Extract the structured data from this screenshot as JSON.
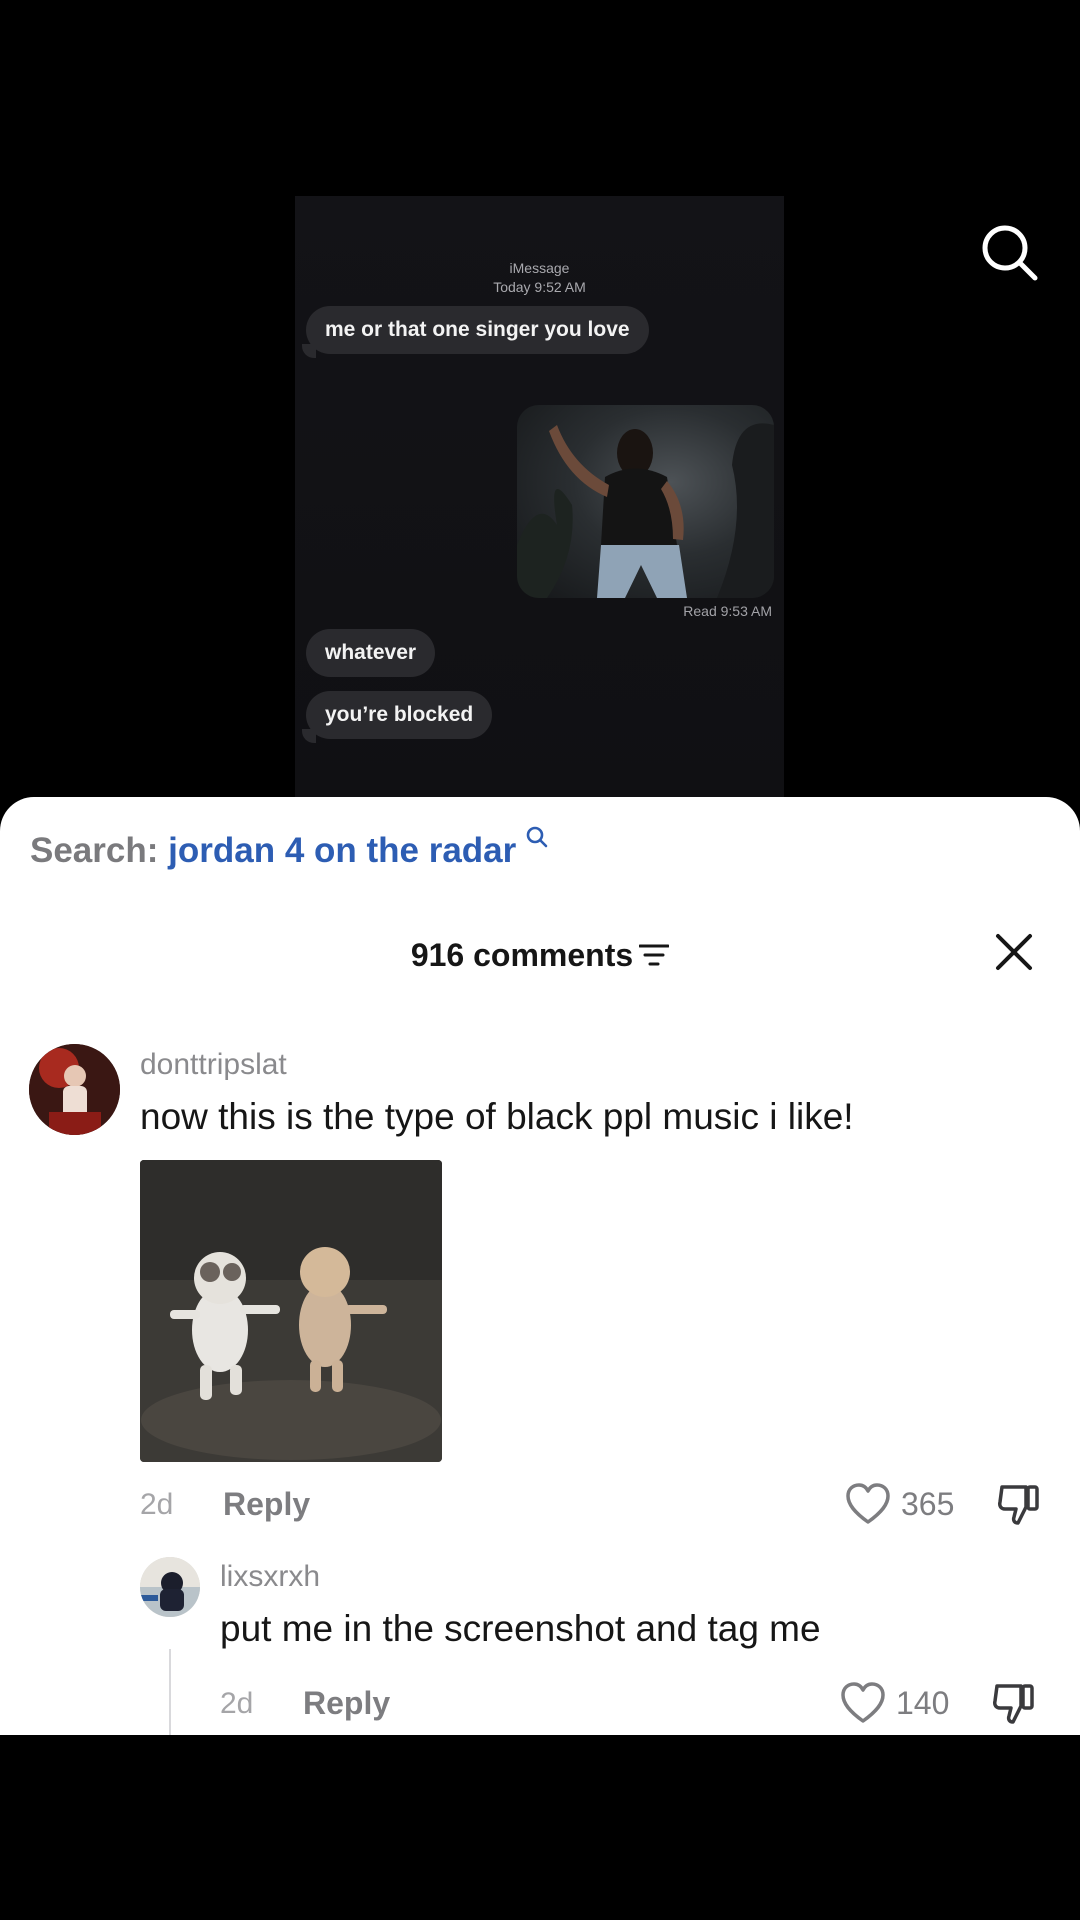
{
  "video": {
    "header_service": "iMessage",
    "header_time": "Today 9:52 AM",
    "messages": [
      {
        "text": "me or that one singer you love"
      },
      {
        "text": "whatever"
      },
      {
        "text": "you’re blocked"
      }
    ],
    "read_receipt": "Read 9:53 AM"
  },
  "top_bar": {
    "search_icon": "search-icon"
  },
  "sheet": {
    "search_prefix": "Search:",
    "search_term": "jordan 4 on the radar",
    "comments_count": "916 comments",
    "filter_icon": "filter-icon",
    "close_icon": "close-icon"
  },
  "comments": [
    {
      "username": "donttripslat",
      "text": "now this is the type of black ppl music i like!",
      "time": "2d",
      "reply_label": "Reply",
      "likes": "365",
      "replies": [
        {
          "username": "lixsxrxh",
          "text": "put me in the screenshot and tag me",
          "time": "2d",
          "reply_label": "Reply",
          "likes": "140"
        }
      ]
    }
  ],
  "colors": {
    "accent_link": "#2d5db3",
    "sheet_bg": "#ffffff",
    "video_bg": "#000000"
  }
}
